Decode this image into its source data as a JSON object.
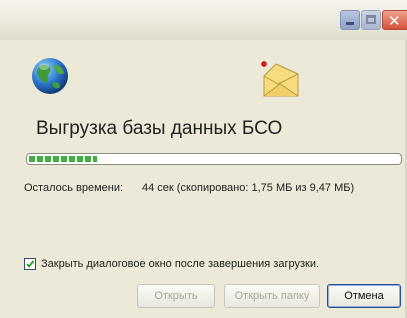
{
  "window": {
    "heading": "Выгрузка базы данных БСО",
    "titlebar_buttons": {
      "minimize_icon": "minimize-icon",
      "maximize_icon": "maximize-icon",
      "close_icon": "close-icon"
    }
  },
  "icons": {
    "globe": "globe-icon",
    "folder": "folder-icon"
  },
  "progress": {
    "fraction": 0.185,
    "color": "#3fae3f"
  },
  "status": {
    "remaining_label": "Осталось времени:",
    "remaining_value": "44 сек (скопировано: 1,75 МБ из 9,47 МБ)"
  },
  "options": {
    "close_on_complete_label": "Закрыть диалоговое окно после завершения загрузки.",
    "close_on_complete_checked": true
  },
  "buttons": {
    "open_label": "Открыть",
    "open_folder_label": "Открыть папку",
    "cancel_label": "Отмена"
  }
}
